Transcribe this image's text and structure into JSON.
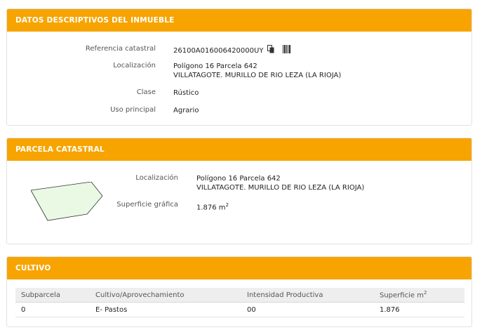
{
  "inmueble": {
    "title": "DATOS DESCRIPTIVOS DEL INMUEBLE",
    "fields": {
      "referencia_label": "Referencia catastral",
      "referencia_value": "26100A016006420000UY",
      "localizacion_label": "Localización",
      "localizacion_line1": "Polígono 16 Parcela 642",
      "localizacion_line2": "VILLATAGOTE. MURILLO DE RIO LEZA (LA RIOJA)",
      "clase_label": "Clase",
      "clase_value": "Rústico",
      "uso_label": "Uso principal",
      "uso_value": "Agrario"
    },
    "icons": [
      "copy-icon",
      "barcode-icon"
    ]
  },
  "parcela": {
    "title": "PARCELA CATASTRAL",
    "localizacion_label": "Localización",
    "localizacion_line1": "Polígono 16 Parcela 642",
    "localizacion_line2": "VILLATAGOTE. MURILLO DE RIO LEZA (LA RIOJA)",
    "superficie_label": "Superficie gráfica",
    "superficie_value": "1.876 m",
    "superficie_unit_sup": "2",
    "map_colors": {
      "fill": "#e9f9e3",
      "stroke": "#333333"
    }
  },
  "cultivo": {
    "title": "CULTIVO",
    "headers": {
      "subparcela": "Subparcela",
      "cultivo": "Cultivo/Aprovechamiento",
      "intensidad": "Intensidad Productiva",
      "superficie": "Superficie m",
      "superficie_sup": "2"
    },
    "rows": [
      {
        "subparcela": "0",
        "cultivo": "E- Pastos",
        "intensidad": "00",
        "superficie": "1.876"
      }
    ]
  },
  "colors": {
    "accent": "#f7a400",
    "panel_border": "#e2e2e2",
    "table_header": "#eeeeee"
  }
}
